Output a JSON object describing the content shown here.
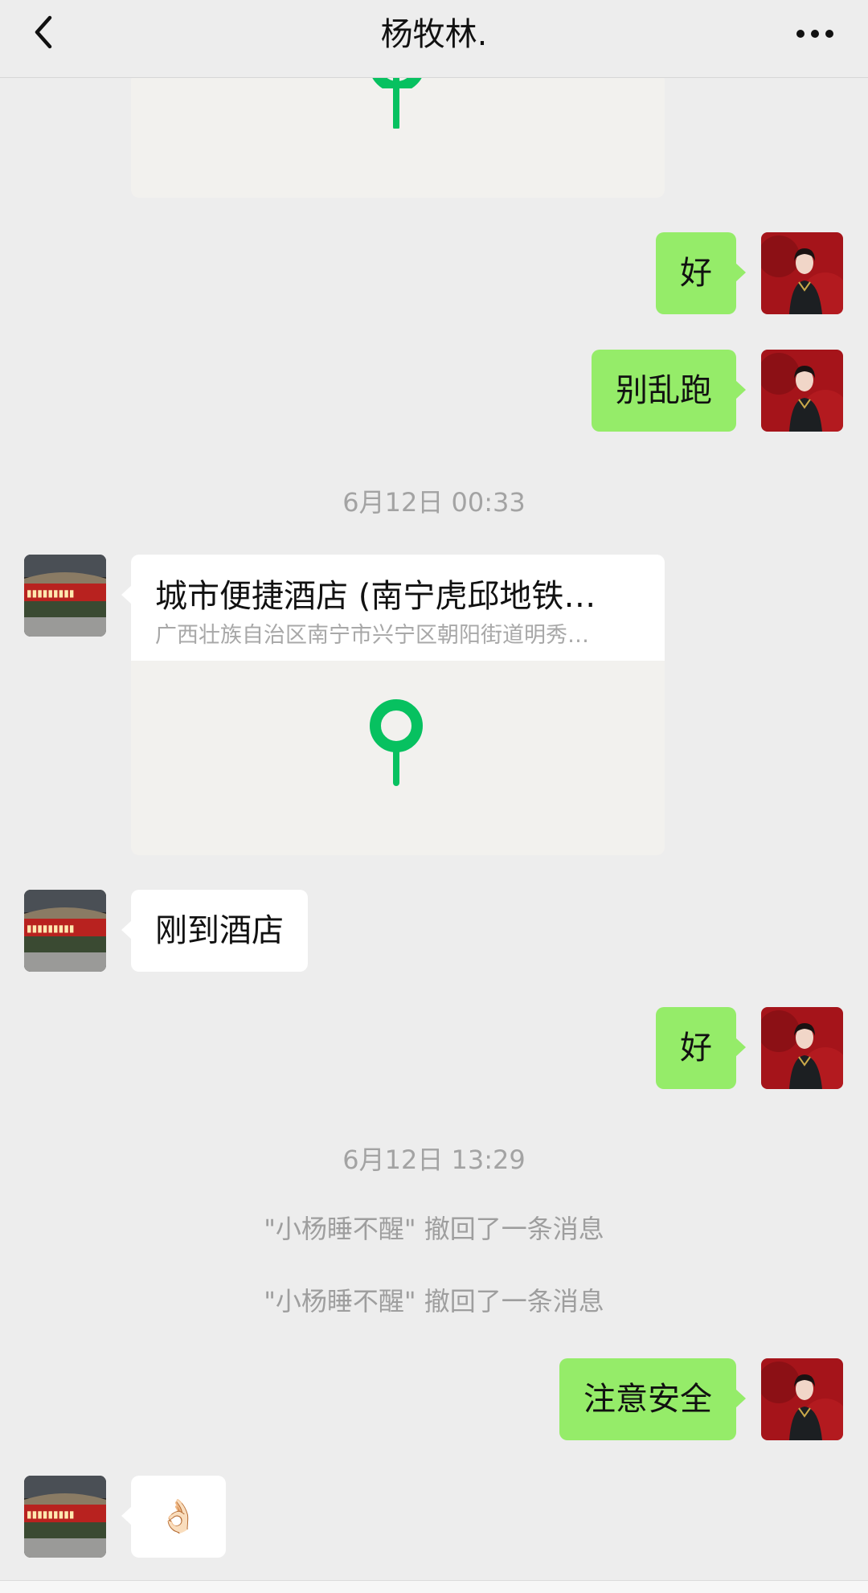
{
  "header": {
    "title": "杨牧林."
  },
  "messages": {
    "m1_text": "好",
    "m2_text": "别乱跑",
    "time1": "6月12日 00:33",
    "location": {
      "name": "城市便捷酒店 (南宁虎邱地铁…",
      "address": "广西壮族自治区南宁市兴宁区朝阳街道明秀…"
    },
    "m3_text": "刚到酒店",
    "m4_text": "好",
    "time2": "6月12日 13:29",
    "recall1": "\"小杨睡不醒\" 撤回了一条消息",
    "recall2": "\"小杨睡不醒\" 撤回了一条消息",
    "m5_text": "注意安全",
    "m6_emoji": "👌🏻"
  },
  "colors": {
    "background": "#ededed",
    "my_bubble": "#95ec69",
    "their_bubble": "#ffffff",
    "map_pin": "#07c160"
  },
  "icons": {
    "back": "chevron-left-icon",
    "more": "more-dots-icon",
    "pin": "map-pin-icon"
  }
}
